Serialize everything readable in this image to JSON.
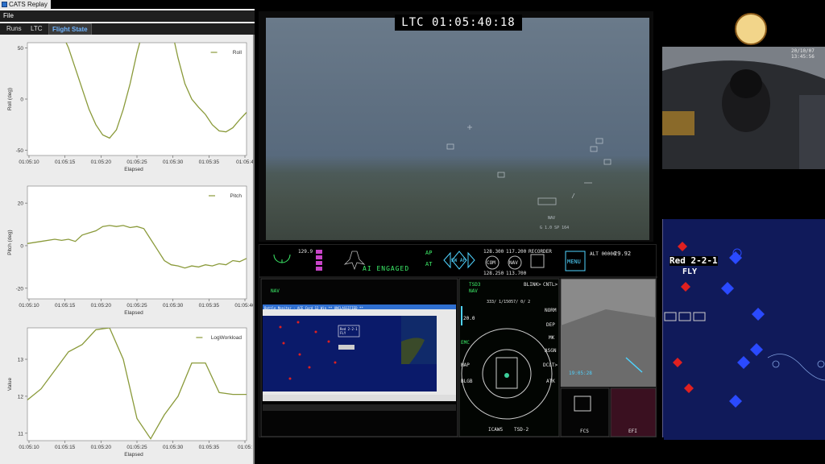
{
  "window": {
    "title": "CATS Replay"
  },
  "menu": {
    "file": "File"
  },
  "tabs": [
    {
      "label": "Runs",
      "active": false
    },
    {
      "label": "LTC",
      "active": false
    },
    {
      "label": "Flight State",
      "active": true
    }
  ],
  "video": {
    "ltc": "LTC 01:05:40:18"
  },
  "cockpit": {
    "ai_status": "AI ENGAGED",
    "ap_label": "AP",
    "at_label": "AT",
    "sw_ap_label": "SW AP",
    "com_label": "COM",
    "nav_label": "NAV",
    "menu_label": "MENU",
    "com_freq_top": "128.300",
    "com_freq_bot": "128.250",
    "nav_freq_top": "117.200",
    "nav_freq_bot": "113.700",
    "recorder_label": "RECORDER",
    "alt_readout": "ALT 00000",
    "baro": "29.92",
    "speed_readout": "129.9",
    "mfd_left_mode": "NAV",
    "mfd_center_top": "TSD3",
    "mfd_center_nav": "NAV",
    "mfd_center_blink": "BLINK>",
    "mfd_center_cntl": "CNTL>",
    "mfd_center_speed": "20.0",
    "mfd_center_emcon": "EMC",
    "mfd_center_map": "MAP",
    "mfd_center_blgb": "BLGB",
    "mfd_center_norm": "NORM",
    "mfd_center_dep": "DEP",
    "mfd_center_mk": "MK",
    "mfd_center_asgn": "ASGN",
    "mfd_center_dclt": "DCLT>",
    "mfd_center_atk": "ATK",
    "mfd_center_icaws": "ICAWS",
    "mfd_center_tsd2": "TSD-2",
    "mfd_center_route": "333/  1/15057/ 0/  2",
    "mfd_right_time": "19:05:28",
    "fcs_label": "FCS",
    "efi_label": "EFI",
    "battle_monitor_title": "Battle Monitor - ACE Card 12 Win   ** UNCLASSIFIED **",
    "callsign_box": "Red 2-2-1 FLY"
  },
  "tacmap": {
    "callsign": "Red 2-2-1",
    "state": "FLY"
  },
  "cockpitcam": {
    "date": "20/10/07",
    "time": "13:45:56"
  },
  "charts_meta": {
    "line_color": "#8a9a3a"
  },
  "chart_data": [
    {
      "type": "line",
      "title": "",
      "xlabel": "Elapsed",
      "ylabel": "Roll (deg)",
      "legend": "Roll",
      "legend_position": "top-right",
      "grid": false,
      "ylim": [
        -55,
        55
      ],
      "yticks": [
        50,
        0,
        -50
      ],
      "xticks": [
        "01:05:10",
        "01:05:15",
        "01:05:20",
        "01:05:25",
        "01:05:30",
        "01:05:35",
        "01:05:4"
      ],
      "xlim": [
        0,
        32
      ],
      "series": [
        {
          "name": "Roll",
          "x": [
            0,
            3,
            5,
            6,
            7,
            8,
            9,
            10,
            11,
            12,
            13,
            14,
            15,
            16,
            17,
            18,
            19,
            20,
            21,
            22,
            23,
            24,
            25,
            26,
            27,
            28,
            29,
            30,
            31,
            32
          ],
          "y": [
            100,
            100,
            65,
            50,
            30,
            10,
            -10,
            -25,
            -35,
            -38,
            -30,
            -10,
            15,
            45,
            70,
            100,
            100,
            100,
            70,
            40,
            15,
            0,
            -8,
            -15,
            -25,
            -31,
            -32,
            -28,
            -20,
            -13
          ]
        }
      ]
    },
    {
      "type": "line",
      "title": "",
      "xlabel": "Elapsed",
      "ylabel": "Pitch (deg)",
      "legend": "Pitch",
      "legend_position": "top-right",
      "grid": false,
      "ylim": [
        -25,
        28
      ],
      "yticks": [
        20,
        0,
        -20
      ],
      "xticks": [
        "01:05:10",
        "01:05:15",
        "01:05:20",
        "01:05:25",
        "01:05:30",
        "01:05:35",
        "01:05:40"
      ],
      "xlim": [
        0,
        32
      ],
      "series": [
        {
          "name": "Pitch",
          "x": [
            0,
            2,
            4,
            5,
            6,
            7,
            8,
            9,
            10,
            11,
            12,
            13,
            14,
            15,
            16,
            17,
            18,
            19,
            20,
            21,
            22,
            23,
            24,
            25,
            26,
            27,
            28,
            29,
            30,
            31,
            32
          ],
          "y": [
            1,
            2,
            3,
            2.5,
            3,
            2,
            5,
            6,
            7,
            9,
            9.5,
            9,
            9.5,
            8.5,
            9,
            8,
            3,
            -2,
            -7,
            -9,
            -9.5,
            -10.5,
            -9.5,
            -10,
            -9,
            -9.5,
            -8.5,
            -9,
            -7,
            -7.5,
            -6
          ]
        }
      ]
    },
    {
      "type": "line",
      "title": "",
      "xlabel": "Elapsed",
      "ylabel": "Value",
      "legend": "LogWorkload",
      "legend_position": "top-right",
      "grid": false,
      "ylim": [
        10.8,
        13.85
      ],
      "yticks": [
        13,
        12,
        11
      ],
      "xticks": [
        "01:05:10",
        "01:05:15",
        "01:05:20",
        "01:05:25",
        "01:05:30",
        "01:05:35",
        "01:05:"
      ],
      "xlim": [
        0,
        32
      ],
      "series": [
        {
          "name": "LogWorkload",
          "x": [
            0,
            2,
            4,
            6,
            8,
            10,
            12,
            14,
            16,
            18,
            20,
            22,
            24,
            26,
            28,
            30,
            32
          ],
          "y": [
            11.9,
            12.2,
            12.7,
            13.2,
            13.4,
            13.8,
            13.85,
            13.0,
            11.4,
            10.85,
            11.5,
            12.0,
            12.9,
            12.9,
            12.1,
            12.05,
            12.05
          ]
        }
      ]
    }
  ]
}
